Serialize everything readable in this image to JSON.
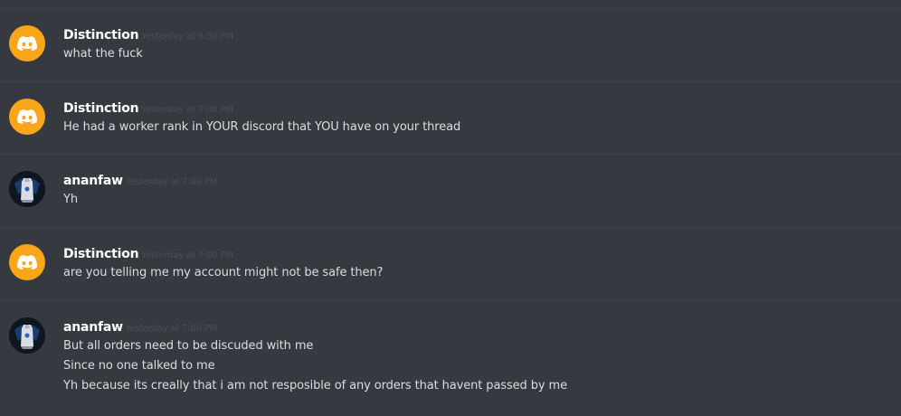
{
  "colors": {
    "background": "#36393f",
    "divider": "#40434a",
    "username": "#ffffff",
    "timestamp": "#4a4d53",
    "message_text": "#dcddde",
    "discord_avatar": "#faa61a"
  },
  "messages": [
    {
      "username": "Distinction",
      "avatar": "discord-logo-icon",
      "timestamp": "Yesterday at 6:59 PM",
      "lines": [
        "what the fuck"
      ]
    },
    {
      "username": "Distinction",
      "avatar": "discord-logo-icon",
      "timestamp": "Yesterday at 7:00 PM",
      "lines": [
        "He had a worker rank in YOUR discord that YOU have on your thread"
      ]
    },
    {
      "username": "ananfaw",
      "avatar": "cape-avatar-icon",
      "timestamp": "Yesterday at 7:00 PM",
      "lines": [
        "Yh"
      ]
    },
    {
      "username": "Distinction",
      "avatar": "discord-logo-icon",
      "timestamp": "Yesterday at 7:00 PM",
      "lines": [
        "are you telling me my account might not be safe then?"
      ]
    },
    {
      "username": "ananfaw",
      "avatar": "cape-avatar-icon",
      "timestamp": "Yesterday at 7:00 PM",
      "lines": [
        "But all orders need to be discuded with me",
        "Since no one talked to me",
        "Yh because its creally that i am not resposible of any orders that havent passed by me"
      ]
    }
  ]
}
